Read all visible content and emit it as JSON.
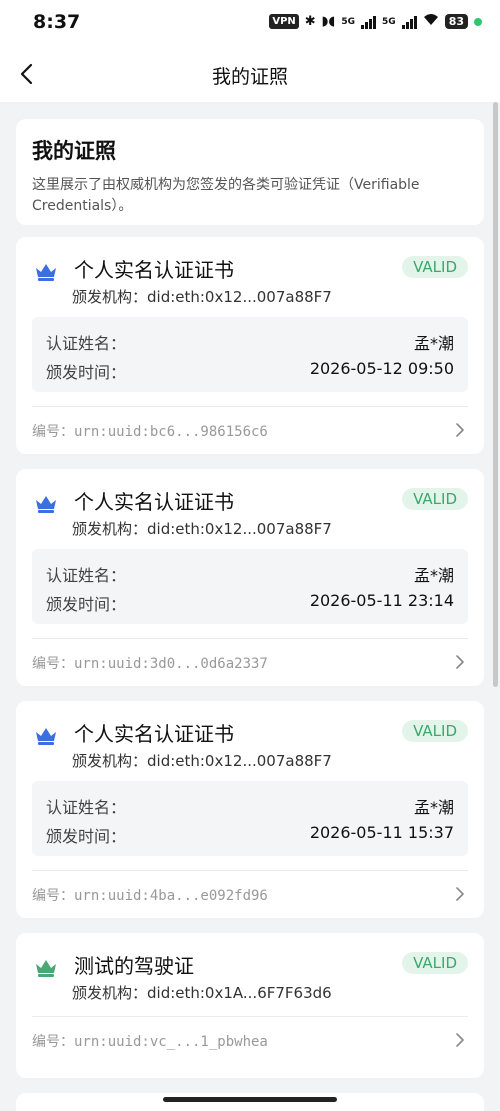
{
  "status": {
    "time": "8:37",
    "vpn": "VPN",
    "sig1": "5G",
    "sig2": "5G",
    "battery": "83"
  },
  "nav": {
    "title": "我的证照"
  },
  "intro": {
    "title": "我的证照",
    "description": "这里展示了由权威机构为您签发的各类可验证凭证（Verifiable Credentials）。"
  },
  "labels": {
    "name": "认证姓名：",
    "time": "颁发时间："
  },
  "credentials": [
    {
      "title": "个人实名认证证书",
      "status": "VALID",
      "issuer": "颁发机构：did:eth:0x12...007a88F7",
      "name": "孟*潮",
      "issued": "2026-05-12 09:50",
      "serial": "编号：urn:uuid:bc6...986156c6",
      "icon_color": "#3a6fe0"
    },
    {
      "title": "个人实名认证证书",
      "status": "VALID",
      "issuer": "颁发机构：did:eth:0x12...007a88F7",
      "name": "孟*潮",
      "issued": "2026-05-11 23:14",
      "serial": "编号：urn:uuid:3d0...0d6a2337",
      "icon_color": "#3a6fe0"
    },
    {
      "title": "个人实名认证证书",
      "status": "VALID",
      "issuer": "颁发机构：did:eth:0x12...007a88F7",
      "name": "孟*潮",
      "issued": "2026-05-11 15:37",
      "serial": "编号：urn:uuid:4ba...e092fd96",
      "icon_color": "#3a6fe0"
    },
    {
      "title": "测试的驾驶证",
      "status": "VALID",
      "issuer": "颁发机构：did:eth:0x1A...6F7F63d6",
      "serial": "编号：urn:uuid:vc_...1_pbwhea",
      "icon_color": "#49a876"
    }
  ]
}
